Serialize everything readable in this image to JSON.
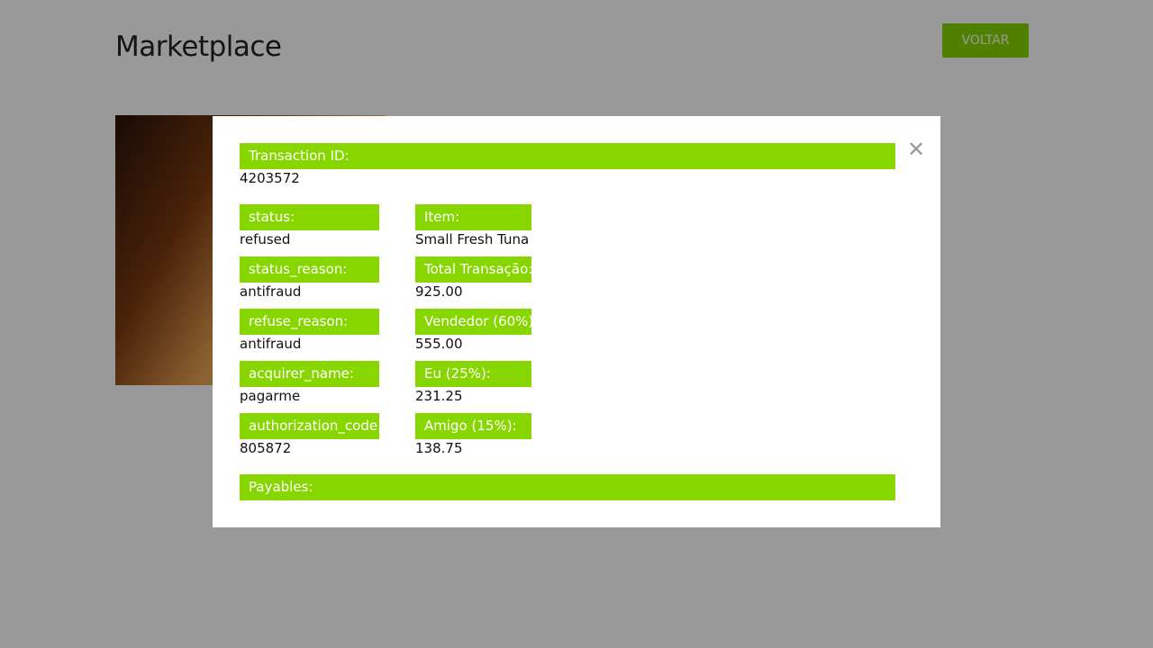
{
  "header": {
    "title": "Marketplace",
    "back_label": "VOLTAR"
  },
  "modal": {
    "close_icon": "close-icon",
    "transaction_id": {
      "label": "Transaction ID:",
      "value": "4203572"
    },
    "left_fields": [
      {
        "label": "status:",
        "value": "refused"
      },
      {
        "label": "status_reason:",
        "value": "antifraud"
      },
      {
        "label": "refuse_reason:",
        "value": "antifraud"
      },
      {
        "label": "acquirer_name:",
        "value": "pagarme"
      },
      {
        "label": "authorization_code:",
        "value": "805872"
      }
    ],
    "right_fields": [
      {
        "label": "Item:",
        "value": "Small Fresh Tuna"
      },
      {
        "label": "Total Transação:",
        "value": "925.00"
      },
      {
        "label": "Vendedor (60%):",
        "value": "555.00"
      },
      {
        "label": "Eu (25%):",
        "value": "231.25"
      },
      {
        "label": "Amigo (15%):",
        "value": "138.75"
      }
    ],
    "payables": {
      "label": "Payables:"
    }
  },
  "colors": {
    "accent": "#88d600",
    "overlay": "rgba(0,0,0,0.4)"
  }
}
